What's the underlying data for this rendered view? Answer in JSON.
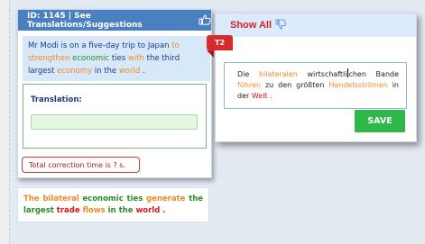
{
  "left_panel": {
    "header_title": "ID: 1145 | See Translations/Suggestions",
    "header_icon": "thumbs-up-icon",
    "source_tokens": [
      {
        "text": "Mr",
        "color": "#1e3a8a"
      },
      {
        "text": "Modi",
        "color": "#1e3a8a"
      },
      {
        "text": "is",
        "color": "#1e3a8a"
      },
      {
        "text": "on",
        "color": "#1e3a8a"
      },
      {
        "text": "a",
        "color": "#1e3a8a"
      },
      {
        "text": "five-day",
        "color": "#1e3a8a"
      },
      {
        "text": "trip",
        "color": "#1e3a8a"
      },
      {
        "text": "to",
        "color": "#1e3a8a"
      },
      {
        "text": "Japan",
        "color": "#1e3a8a"
      },
      {
        "text": "to",
        "color": "#f0892a"
      },
      {
        "text": "strengthen",
        "color": "#f0892a"
      },
      {
        "text": "economic",
        "color": "#2c8a2c"
      },
      {
        "text": "ties",
        "color": "#1e3a8a"
      },
      {
        "text": "with",
        "color": "#f0892a"
      },
      {
        "text": "the",
        "color": "#1e3a8a"
      },
      {
        "text": "third",
        "color": "#1e3a8a"
      },
      {
        "text": "largest",
        "color": "#1e3a8a"
      },
      {
        "text": "economy",
        "color": "#f0892a"
      },
      {
        "text": "in",
        "color": "#1e3a8a"
      },
      {
        "text": "the",
        "color": "#1e3a8a"
      },
      {
        "text": "world",
        "color": "#f0892a"
      },
      {
        "text": ".",
        "color": "#1e3a8a"
      }
    ],
    "translation_label": "Translation:",
    "translation_value": "",
    "correction_time": "Total correction time is ? s."
  },
  "reference": {
    "tokens": [
      {
        "text": "The",
        "color": "#f0892a"
      },
      {
        "text": "bilateral",
        "color": "#f0892a"
      },
      {
        "text": "economic",
        "color": "#2c8a2c"
      },
      {
        "text": "ties",
        "color": "#2c8a2c"
      },
      {
        "text": "generate",
        "color": "#f0892a"
      },
      {
        "text": "the",
        "color": "#2c8a2c"
      },
      {
        "text": "largest",
        "color": "#2c8a2c"
      },
      {
        "text": "trade",
        "color": "#d81818"
      },
      {
        "text": "flows",
        "color": "#f0892a"
      },
      {
        "text": "in",
        "color": "#2c8a2c"
      },
      {
        "text": "the",
        "color": "#2c8a2c"
      },
      {
        "text": "world",
        "color": "#d81818"
      },
      {
        "text": ".",
        "color": "#d81818"
      }
    ]
  },
  "right_panel": {
    "show_all_label": "Show All",
    "show_all_icon": "thumbs-down-icon",
    "tag_label": "T2",
    "target_tokens": [
      {
        "text": "Die",
        "color": "#222222"
      },
      {
        "text": "bilateralen",
        "color": "#f0892a"
      },
      {
        "text": "wirtschaftlichen",
        "color": "#222222",
        "cursor_after": 12
      },
      {
        "text": "Bande",
        "color": "#222222"
      },
      {
        "text": "führen",
        "color": "#f0892a"
      },
      {
        "text": "zu",
        "color": "#222222"
      },
      {
        "text": "den",
        "color": "#222222"
      },
      {
        "text": "größten",
        "color": "#222222"
      },
      {
        "text": "Handelsströmen",
        "color": "#f0892a"
      },
      {
        "text": "in",
        "color": "#222222"
      },
      {
        "text": "der",
        "color": "#222222"
      },
      {
        "text": "Welt",
        "color": "#d81818"
      },
      {
        "text": ".",
        "color": "#d81818"
      }
    ],
    "save_label": "SAVE"
  },
  "colors": {
    "header_blue": "#4a7fc0",
    "save_green": "#2fb84a",
    "tag_red": "#d72a2a"
  }
}
